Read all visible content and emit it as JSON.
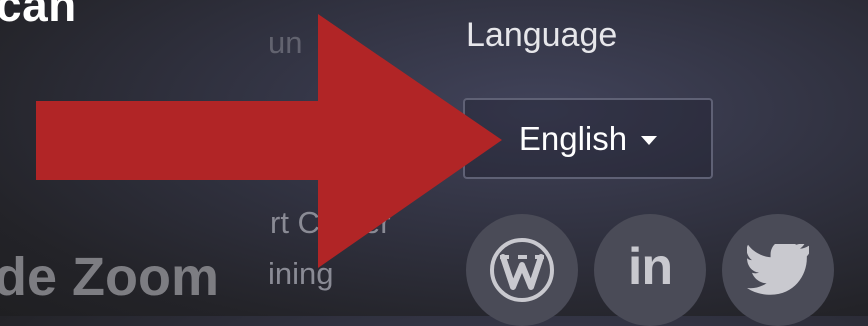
{
  "background_text": {
    "heading": "can",
    "ghost_link": "un",
    "support_link": "rt Center",
    "training_link": "ining",
    "brand": "de Zoom"
  },
  "language": {
    "title": "Language",
    "selected": "English"
  },
  "social": [
    {
      "name": "WordPress",
      "icon": "wordpress-icon"
    },
    {
      "name": "LinkedIn",
      "icon": "linkedin-icon",
      "glyph": "in"
    },
    {
      "name": "Twitter",
      "icon": "twitter-icon"
    }
  ],
  "annotation": {
    "arrow_color": "#b12526"
  },
  "colors": {
    "background": "#30313f",
    "social_circle": "#4a4b57",
    "select_border": "#5f6175"
  }
}
